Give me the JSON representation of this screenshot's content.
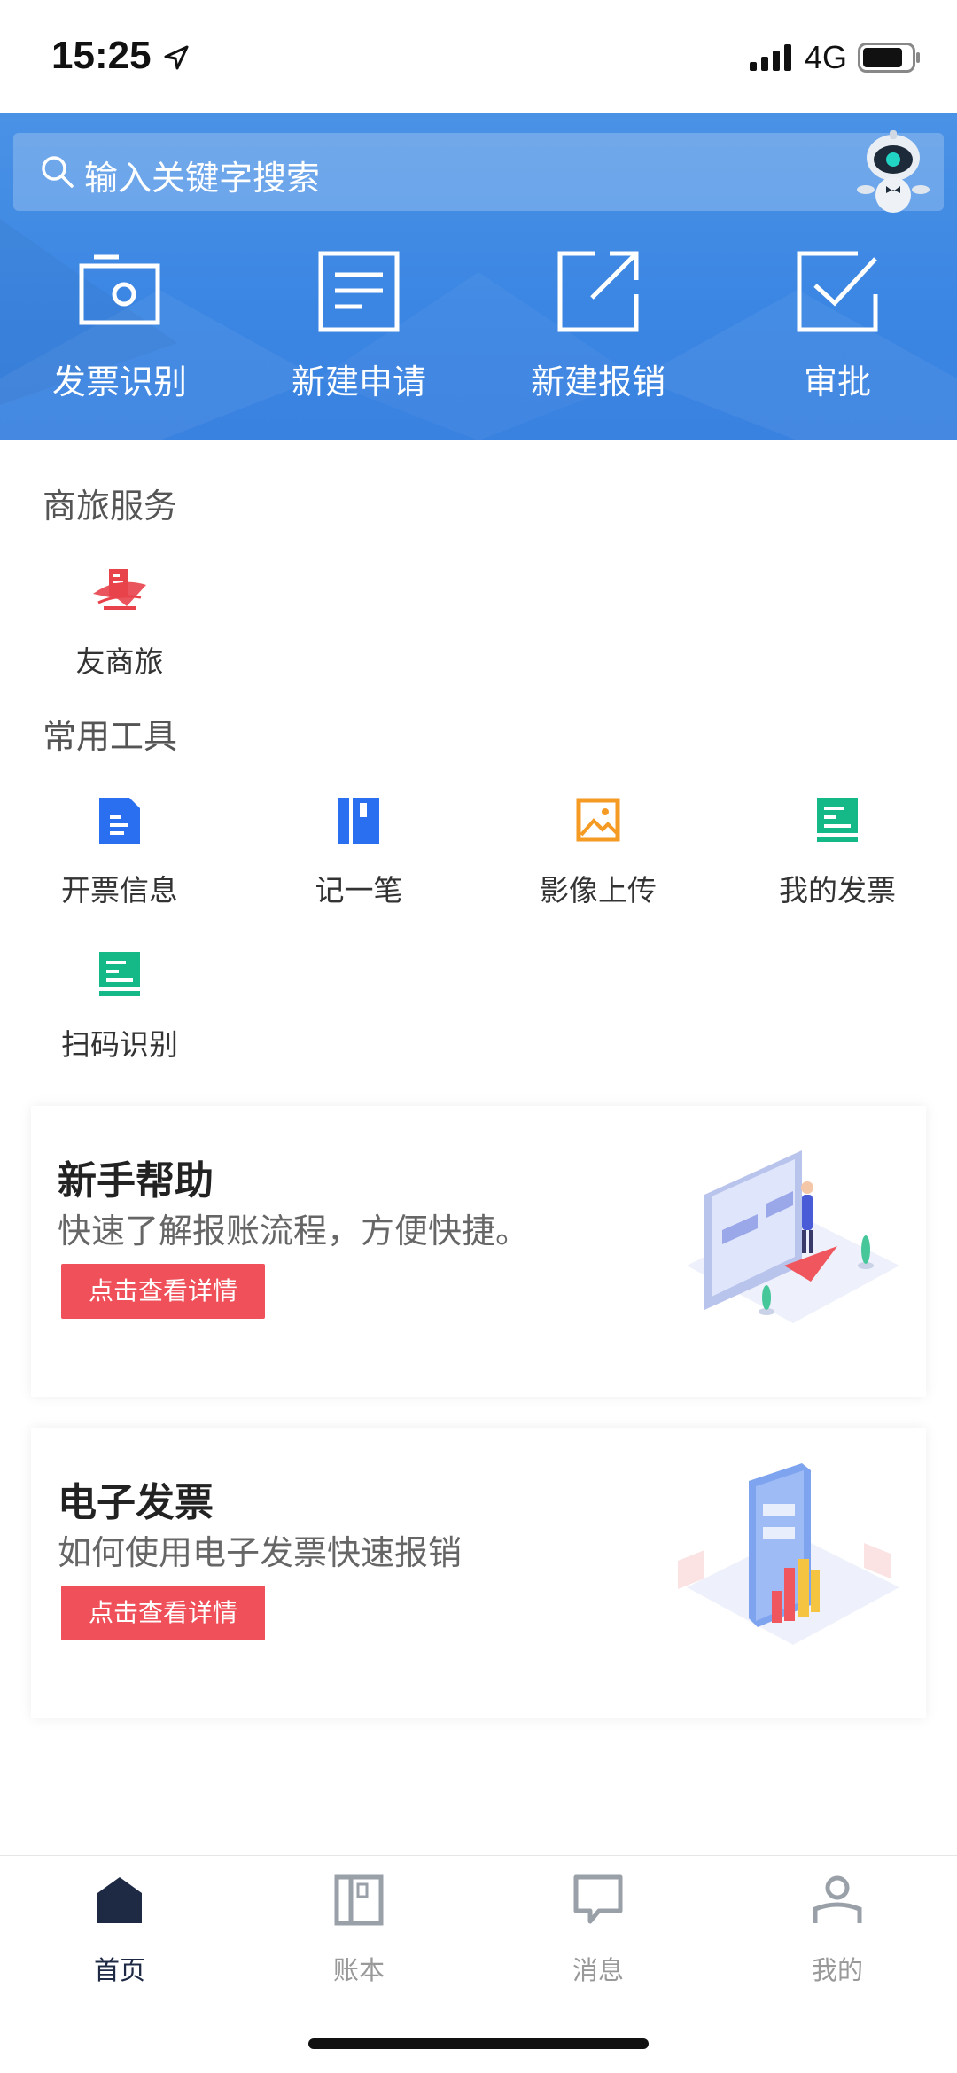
{
  "status_bar": {
    "time": "15:25",
    "network": "4G"
  },
  "search": {
    "placeholder": "输入关键字搜索"
  },
  "quick_actions": [
    {
      "label": "发票识别",
      "icon": "camera-icon"
    },
    {
      "label": "新建申请",
      "icon": "document-icon"
    },
    {
      "label": "新建报销",
      "icon": "external-link-icon"
    },
    {
      "label": "审批",
      "icon": "checkbox-icon"
    }
  ],
  "travel_section": {
    "title": "商旅服务",
    "items": [
      {
        "label": "友商旅",
        "icon": "travel-logo-icon",
        "color": "#e8434b"
      }
    ]
  },
  "tools_section": {
    "title": "常用工具",
    "items": [
      {
        "label": "开票信息",
        "icon": "invoice-info-icon",
        "color": "#2a6ff0"
      },
      {
        "label": "记一笔",
        "icon": "notebook-icon",
        "color": "#2a6ff0"
      },
      {
        "label": "影像上传",
        "icon": "image-upload-icon",
        "color": "#f59a23"
      },
      {
        "label": "我的发票",
        "icon": "my-invoice-icon",
        "color": "#14b987"
      },
      {
        "label": "扫码识别",
        "icon": "scan-code-icon",
        "color": "#14b987"
      }
    ]
  },
  "cards": [
    {
      "title": "新手帮助",
      "desc": "快速了解报账流程，方便快捷。",
      "button": "点击查看详情"
    },
    {
      "title": "电子发票",
      "desc": "如何使用电子发票快速报销",
      "button": "点击查看详情"
    }
  ],
  "bottom_nav": [
    {
      "label": "首页",
      "icon": "home-icon",
      "active": true
    },
    {
      "label": "账本",
      "icon": "ledger-icon",
      "active": false
    },
    {
      "label": "消息",
      "icon": "message-icon",
      "active": false
    },
    {
      "label": "我的",
      "icon": "profile-icon",
      "active": false
    }
  ],
  "colors": {
    "header_blue": "#3b86e3",
    "button_red": "#ef5059",
    "nav_active": "#1e2a44",
    "nav_inactive": "#999999"
  }
}
